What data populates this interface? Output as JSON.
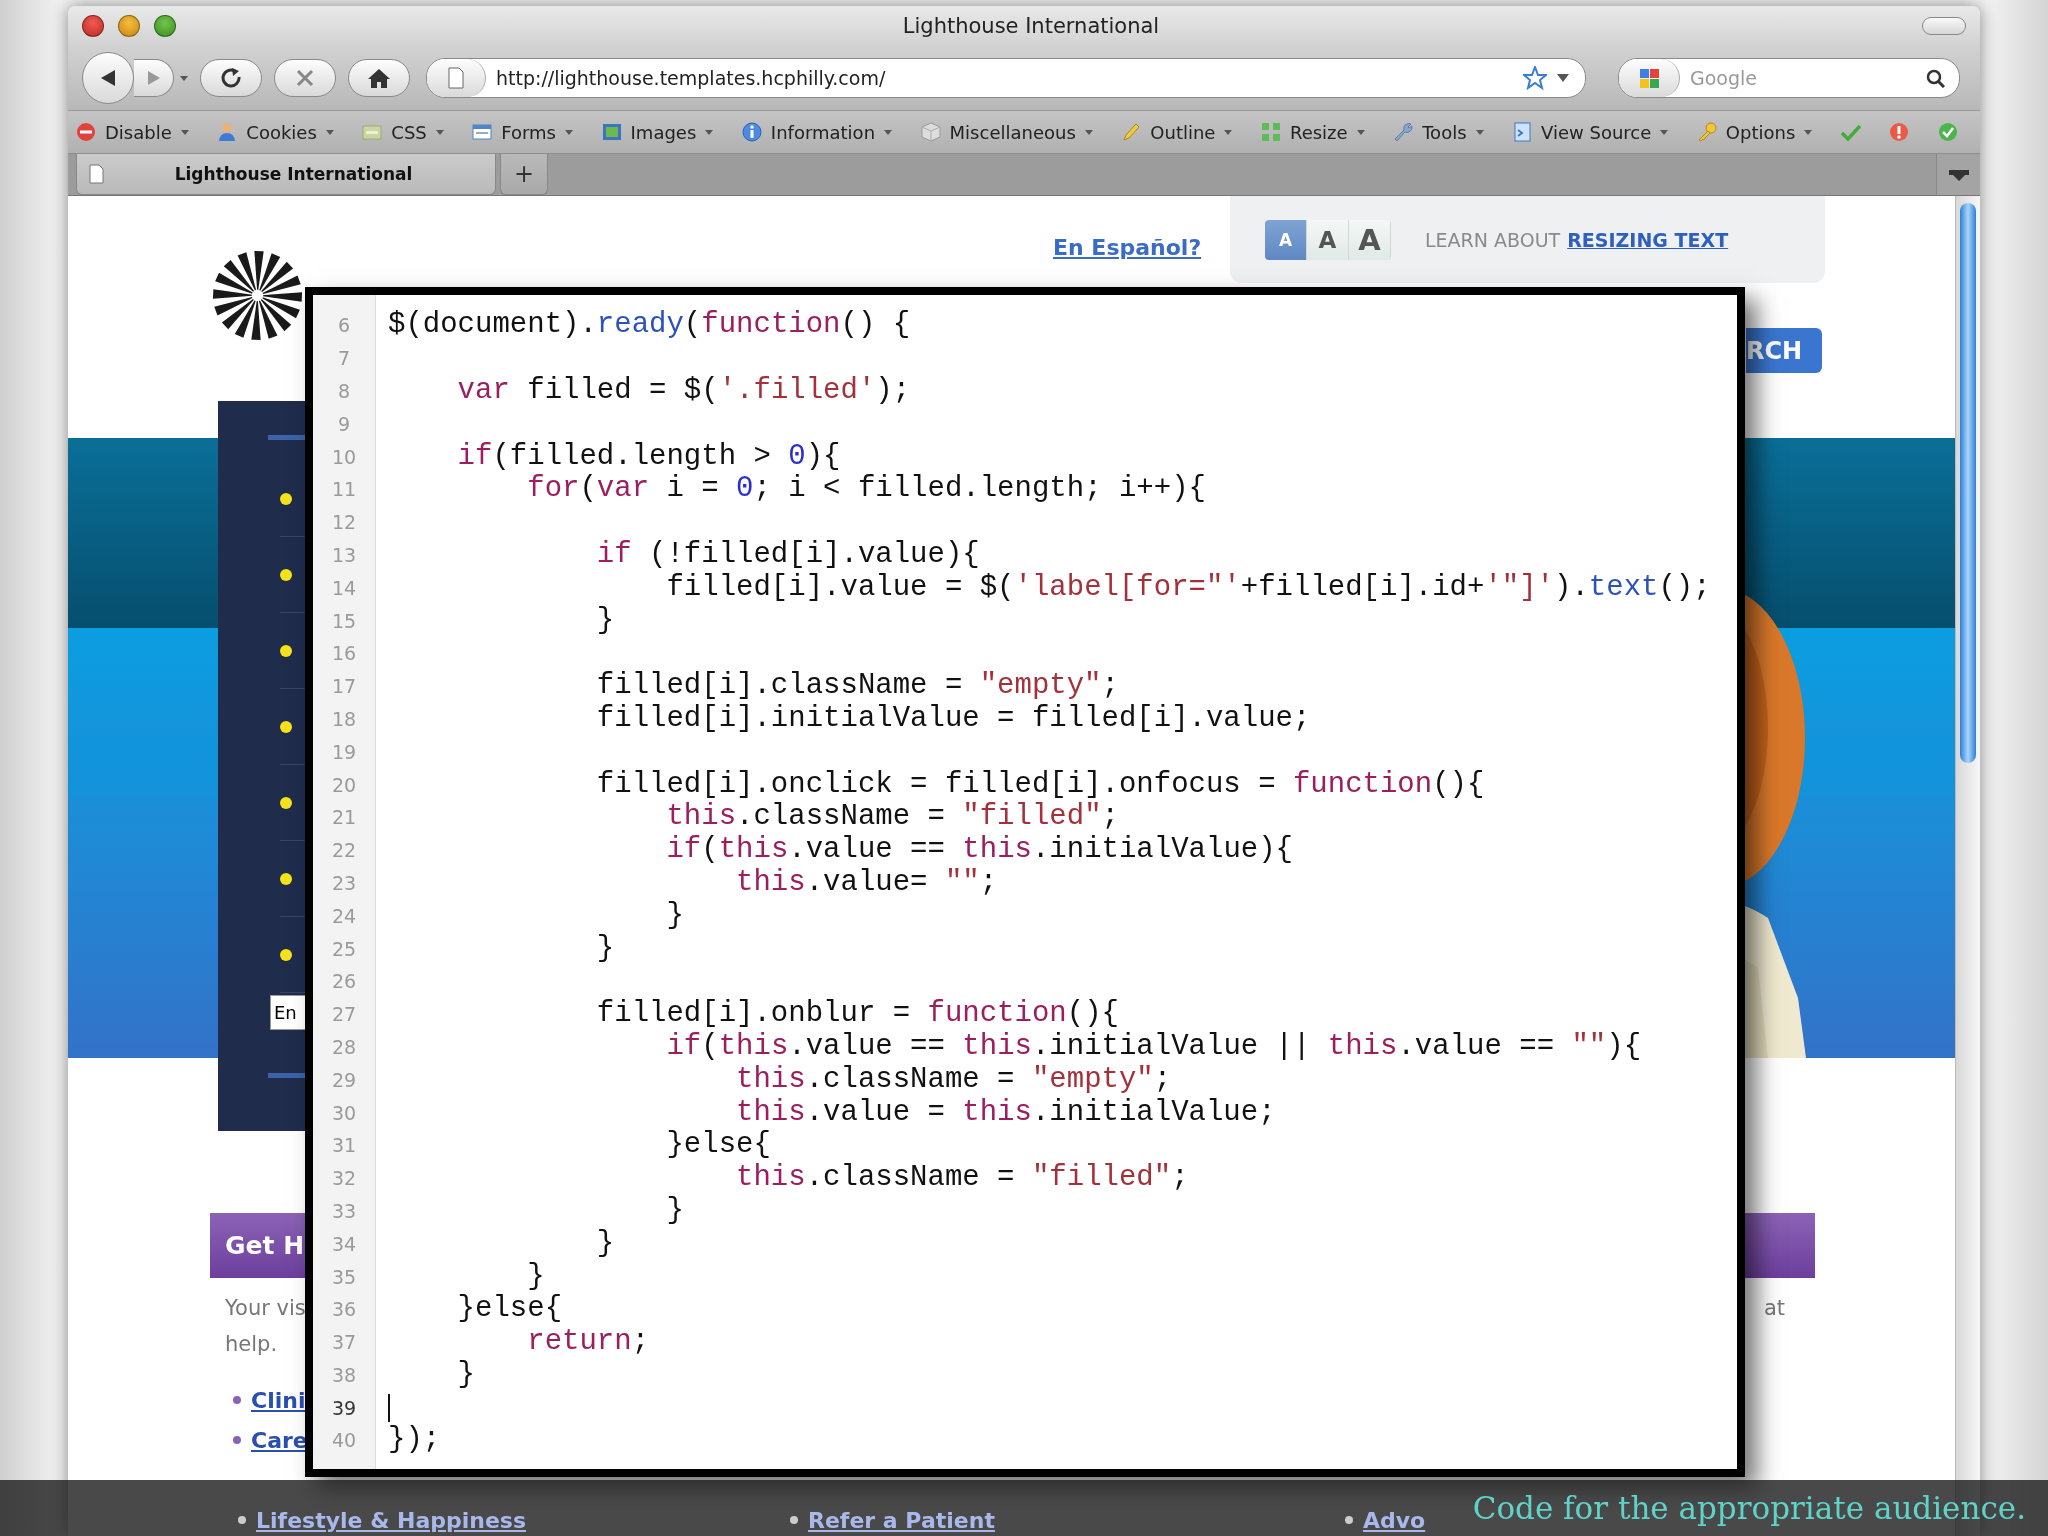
{
  "window": {
    "title": "Lighthouse International"
  },
  "navigation": {
    "url": "http://lighthouse.templates.hcphilly.com/",
    "search": {
      "placeholder": "Google"
    }
  },
  "bookmarks_toolbar": {
    "menus": [
      {
        "label": "Disable"
      },
      {
        "label": "Cookies"
      },
      {
        "label": "CSS"
      },
      {
        "label": "Forms"
      },
      {
        "label": "Images"
      },
      {
        "label": "Information"
      },
      {
        "label": "Miscellaneous"
      },
      {
        "label": "Outline"
      },
      {
        "label": "Resize"
      },
      {
        "label": "Tools"
      },
      {
        "label": "View Source"
      },
      {
        "label": "Options"
      }
    ]
  },
  "tabs": [
    {
      "label": "Lighthouse International",
      "selected": true
    }
  ],
  "new_tab_label": "+",
  "page": {
    "language_link": "En Español?",
    "text_size": {
      "buttons": [
        {
          "label": "A",
          "selected": true
        },
        {
          "label": "A",
          "selected": false
        },
        {
          "label": "A",
          "selected": false
        }
      ],
      "label": "LEARN ABOUT",
      "link": "RESIZING TEXT"
    },
    "search_button": "RCH",
    "sidebar": {
      "field_value": "En"
    },
    "get_help": {
      "heading": "Get H",
      "text_lines": [
        "Your vis",
        "help."
      ],
      "side_text": "at",
      "links": [
        "Clini",
        "Care"
      ]
    },
    "footer_links": [
      "Lifestyle & Happiness",
      "Refer a Patient",
      "Advo"
    ]
  },
  "editor": {
    "lines": [
      {
        "number": "6",
        "current": false,
        "tokens": [
          {
            "text": "$(document).",
            "kind": "plain"
          },
          {
            "text": "ready",
            "kind": "method"
          },
          {
            "text": "(",
            "kind": "plain"
          },
          {
            "text": "function",
            "kind": "keyword"
          },
          {
            "text": "() {",
            "kind": "plain"
          }
        ]
      },
      {
        "number": "7",
        "current": false
      },
      {
        "number": "8",
        "current": false,
        "tokens": [
          {
            "text": "    var",
            "kind": "keyword"
          },
          {
            "text": " filled = $(",
            "kind": "plain"
          },
          {
            "text": "'.filled'",
            "kind": "string"
          },
          {
            "text": ");",
            "kind": "plain"
          }
        ]
      },
      {
        "number": "9",
        "current": false
      },
      {
        "number": "10",
        "current": false,
        "tokens": [
          {
            "text": "    if",
            "kind": "keyword"
          },
          {
            "text": "(filled.length > ",
            "kind": "plain"
          },
          {
            "text": "0",
            "kind": "number"
          },
          {
            "text": "){",
            "kind": "plain"
          }
        ]
      },
      {
        "number": "11",
        "current": false,
        "tokens": [
          {
            "text": "        for",
            "kind": "keyword"
          },
          {
            "text": "(",
            "kind": "plain"
          },
          {
            "text": "var",
            "kind": "keyword"
          },
          {
            "text": " i = ",
            "kind": "plain"
          },
          {
            "text": "0",
            "kind": "number"
          },
          {
            "text": "; i < filled.length; i++){",
            "kind": "plain"
          }
        ]
      },
      {
        "number": "12",
        "current": false
      },
      {
        "number": "13",
        "current": false,
        "tokens": [
          {
            "text": "            if",
            "kind": "keyword"
          },
          {
            "text": " (!filled[i].value){",
            "kind": "plain"
          }
        ]
      },
      {
        "number": "14",
        "current": false,
        "tokens": [
          {
            "text": "                filled[i].value = $(",
            "kind": "plain"
          },
          {
            "text": "'label[for=\"'",
            "kind": "string"
          },
          {
            "text": "+filled[i].id+",
            "kind": "plain"
          },
          {
            "text": "'\"]'",
            "kind": "string"
          },
          {
            "text": ").",
            "kind": "plain"
          },
          {
            "text": "text",
            "kind": "method"
          },
          {
            "text": "();",
            "kind": "plain"
          }
        ]
      },
      {
        "number": "15",
        "current": false,
        "tokens": [
          {
            "text": "            }",
            "kind": "plain"
          }
        ]
      },
      {
        "number": "16",
        "current": false
      },
      {
        "number": "17",
        "current": false,
        "tokens": [
          {
            "text": "            filled[i].className = ",
            "kind": "plain"
          },
          {
            "text": "\"empty\"",
            "kind": "string"
          },
          {
            "text": ";",
            "kind": "plain"
          }
        ]
      },
      {
        "number": "18",
        "current": false,
        "tokens": [
          {
            "text": "            filled[i].initialValue = filled[i].value;",
            "kind": "plain"
          }
        ]
      },
      {
        "number": "19",
        "current": false
      },
      {
        "number": "20",
        "current": false,
        "tokens": [
          {
            "text": "            filled[i].onclick = filled[i].onfocus = ",
            "kind": "plain"
          },
          {
            "text": "function",
            "kind": "keyword"
          },
          {
            "text": "(){",
            "kind": "plain"
          }
        ]
      },
      {
        "number": "21",
        "current": false,
        "tokens": [
          {
            "text": "                this",
            "kind": "keyword"
          },
          {
            "text": ".className = ",
            "kind": "plain"
          },
          {
            "text": "\"filled\"",
            "kind": "string"
          },
          {
            "text": ";",
            "kind": "plain"
          }
        ]
      },
      {
        "number": "22",
        "current": false,
        "tokens": [
          {
            "text": "                if",
            "kind": "keyword"
          },
          {
            "text": "(",
            "kind": "plain"
          },
          {
            "text": "this",
            "kind": "keyword"
          },
          {
            "text": ".value == ",
            "kind": "plain"
          },
          {
            "text": "this",
            "kind": "keyword"
          },
          {
            "text": ".initialValue){",
            "kind": "plain"
          }
        ]
      },
      {
        "number": "23",
        "current": false,
        "tokens": [
          {
            "text": "                    this",
            "kind": "keyword"
          },
          {
            "text": ".value= ",
            "kind": "plain"
          },
          {
            "text": "\"\"",
            "kind": "string"
          },
          {
            "text": ";",
            "kind": "plain"
          }
        ]
      },
      {
        "number": "24",
        "current": false,
        "tokens": [
          {
            "text": "                }",
            "kind": "plain"
          }
        ]
      },
      {
        "number": "25",
        "current": false,
        "tokens": [
          {
            "text": "            }",
            "kind": "plain"
          }
        ]
      },
      {
        "number": "26",
        "current": false
      },
      {
        "number": "27",
        "current": false,
        "tokens": [
          {
            "text": "            filled[i].onblur = ",
            "kind": "plain"
          },
          {
            "text": "function",
            "kind": "keyword"
          },
          {
            "text": "(){",
            "kind": "plain"
          }
        ]
      },
      {
        "number": "28",
        "current": false,
        "tokens": [
          {
            "text": "                if",
            "kind": "keyword"
          },
          {
            "text": "(",
            "kind": "plain"
          },
          {
            "text": "this",
            "kind": "keyword"
          },
          {
            "text": ".value == ",
            "kind": "plain"
          },
          {
            "text": "this",
            "kind": "keyword"
          },
          {
            "text": ".initialValue || ",
            "kind": "plain"
          },
          {
            "text": "this",
            "kind": "keyword"
          },
          {
            "text": ".value == ",
            "kind": "plain"
          },
          {
            "text": "\"\"",
            "kind": "string"
          },
          {
            "text": "){",
            "kind": "plain"
          }
        ]
      },
      {
        "number": "29",
        "current": false,
        "tokens": [
          {
            "text": "                    this",
            "kind": "keyword"
          },
          {
            "text": ".className = ",
            "kind": "plain"
          },
          {
            "text": "\"empty\"",
            "kind": "string"
          },
          {
            "text": ";",
            "kind": "plain"
          }
        ]
      },
      {
        "number": "30",
        "current": false,
        "tokens": [
          {
            "text": "                    this",
            "kind": "keyword"
          },
          {
            "text": ".value = ",
            "kind": "plain"
          },
          {
            "text": "this",
            "kind": "keyword"
          },
          {
            "text": ".initialValue;",
            "kind": "plain"
          }
        ]
      },
      {
        "number": "31",
        "current": false,
        "tokens": [
          {
            "text": "                }else{",
            "kind": "plain"
          }
        ]
      },
      {
        "number": "32",
        "current": false,
        "tokens": [
          {
            "text": "                    this",
            "kind": "keyword"
          },
          {
            "text": ".className = ",
            "kind": "plain"
          },
          {
            "text": "\"filled\"",
            "kind": "string"
          },
          {
            "text": ";",
            "kind": "plain"
          }
        ]
      },
      {
        "number": "33",
        "current": false,
        "tokens": [
          {
            "text": "                }",
            "kind": "plain"
          }
        ]
      },
      {
        "number": "34",
        "current": false,
        "tokens": [
          {
            "text": "            }",
            "kind": "plain"
          }
        ]
      },
      {
        "number": "35",
        "current": false,
        "tokens": [
          {
            "text": "        }",
            "kind": "plain"
          }
        ]
      },
      {
        "number": "36",
        "current": false,
        "tokens": [
          {
            "text": "    }else{",
            "kind": "plain"
          }
        ]
      },
      {
        "number": "37",
        "current": false,
        "tokens": [
          {
            "text": "        return",
            "kind": "keyword"
          },
          {
            "text": ";",
            "kind": "plain"
          }
        ]
      },
      {
        "number": "38",
        "current": false,
        "tokens": [
          {
            "text": "    }",
            "kind": "plain"
          }
        ]
      },
      {
        "number": "39",
        "current": true
      },
      {
        "number": "40",
        "current": false,
        "tokens": [
          {
            "text": "});",
            "kind": "plain"
          }
        ]
      }
    ]
  },
  "caption": "Code for the appropriate audience."
}
